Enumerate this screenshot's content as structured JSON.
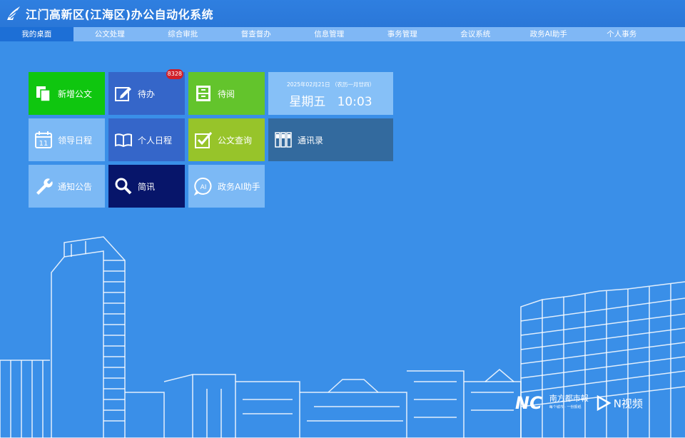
{
  "header": {
    "title": "江门高新区(江海区)办公自动化系统"
  },
  "nav": [
    {
      "label": "我的桌面"
    },
    {
      "label": "公文处理"
    },
    {
      "label": "综合审批"
    },
    {
      "label": "督查督办"
    },
    {
      "label": "信息管理"
    },
    {
      "label": "事务管理"
    },
    {
      "label": "会议系统"
    },
    {
      "label": "政务AI助手"
    },
    {
      "label": "个人事务"
    }
  ],
  "tiles": {
    "new_doc": {
      "label": "新增公文",
      "color": "#0fc60f"
    },
    "todo": {
      "label": "待办",
      "badge": "8328",
      "color": "#3566c9"
    },
    "to_read": {
      "label": "待阅",
      "color": "#63c42c"
    },
    "leader_schedule": {
      "label": "领导日程",
      "color": "#7cb9f5"
    },
    "personal_schedule": {
      "label": "个人日程",
      "color": "#3566c9"
    },
    "doc_search": {
      "label": "公文查询",
      "color": "#97c42a"
    },
    "contacts": {
      "label": "通讯录",
      "color": "#336a9e"
    },
    "notice": {
      "label": "通知公告",
      "color": "#7cb9f5"
    },
    "briefing": {
      "label": "简讯",
      "color": "#07156a"
    },
    "ai_assistant": {
      "label": "政务AI助手",
      "color": "#7cb9f5"
    }
  },
  "calendar_icon_day": "11",
  "ai_icon_text": "AI",
  "clock": {
    "date": "2025年02月21日 （农历一月廿四）",
    "weekday_time": "星期五   10:03"
  },
  "watermark": {
    "nc": "NC",
    "paper": "南方都市報",
    "paper_sub": "每个城市 · 一份报纸",
    "video": "N视频"
  }
}
